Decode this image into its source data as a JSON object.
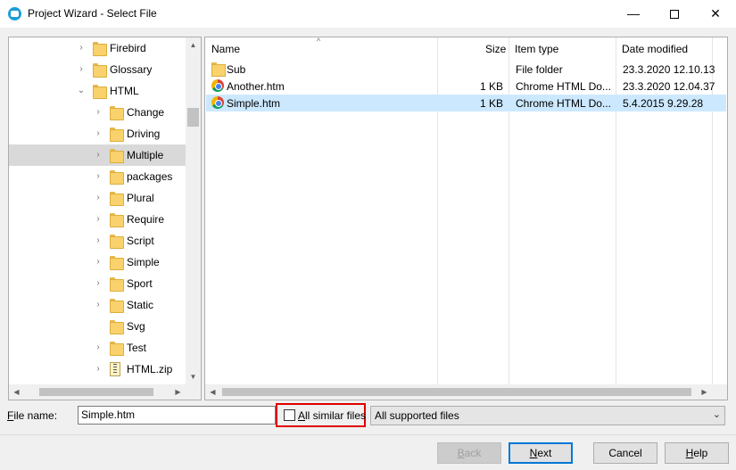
{
  "window": {
    "title": "Project Wizard - Select File",
    "minimize_glyph": "—",
    "close_glyph": "✕"
  },
  "tree": {
    "items": [
      {
        "label": "Firebird",
        "expander": "›",
        "icon": "folder-icon"
      },
      {
        "label": "Glossary",
        "expander": "›",
        "icon": "folder-icon"
      },
      {
        "label": "HTML",
        "expander": "⌄",
        "icon": "folder-icon"
      },
      {
        "label": "Change",
        "expander": "›",
        "icon": "folder-icon"
      },
      {
        "label": "Driving",
        "expander": "›",
        "icon": "folder-icon"
      },
      {
        "label": "Multiple",
        "expander": "›",
        "icon": "folder-icon",
        "selected": true
      },
      {
        "label": "packages",
        "expander": "›",
        "icon": "folder-icon"
      },
      {
        "label": "Plural",
        "expander": "›",
        "icon": "folder-icon"
      },
      {
        "label": "Require",
        "expander": "›",
        "icon": "folder-icon"
      },
      {
        "label": "Script",
        "expander": "›",
        "icon": "folder-icon"
      },
      {
        "label": "Simple",
        "expander": "›",
        "icon": "folder-icon"
      },
      {
        "label": "Sport",
        "expander": "›",
        "icon": "folder-icon"
      },
      {
        "label": "Static",
        "expander": "›",
        "icon": "folder-icon"
      },
      {
        "label": "Svg",
        "expander": "",
        "icon": "folder-icon"
      },
      {
        "label": "Test",
        "expander": "›",
        "icon": "folder-icon"
      },
      {
        "label": "HTML.zip",
        "expander": "›",
        "icon": "zip-icon"
      }
    ]
  },
  "file_list": {
    "columns": {
      "name": "Name",
      "size": "Size",
      "type": "Item type",
      "date": "Date modified"
    },
    "rows": [
      {
        "name": "Sub",
        "size": "",
        "type": "File folder",
        "date": "23.3.2020 12.10.13",
        "icon": "folder-icon"
      },
      {
        "name": "Another.htm",
        "size": "1 KB",
        "type": "Chrome HTML Do...",
        "date": "23.3.2020 12.04.37",
        "icon": "chrome-icon"
      },
      {
        "name": "Simple.htm",
        "size": "1 KB",
        "type": "Chrome HTML Do...",
        "date": "5.4.2015 9.29.28",
        "icon": "chrome-icon",
        "selected": true
      }
    ]
  },
  "footer": {
    "file_name_label_first": "F",
    "file_name_label_rest": "ile name:",
    "file_name_value": "Simple.htm",
    "similar_first": "A",
    "similar_rest": "ll similar files",
    "similar_checked": false,
    "filter_value": "All supported files"
  },
  "buttons": {
    "back_first": "B",
    "back_rest": "ack",
    "next_first": "N",
    "next_rest": "ext",
    "cancel_label": "Cancel",
    "help_first": "H",
    "help_rest": "elp"
  },
  "colors": {
    "selection_list": "#cce8ff",
    "selection_tree": "#d9d9d9",
    "highlight_box": "#e00000",
    "default_button_border": "#0078d7"
  }
}
